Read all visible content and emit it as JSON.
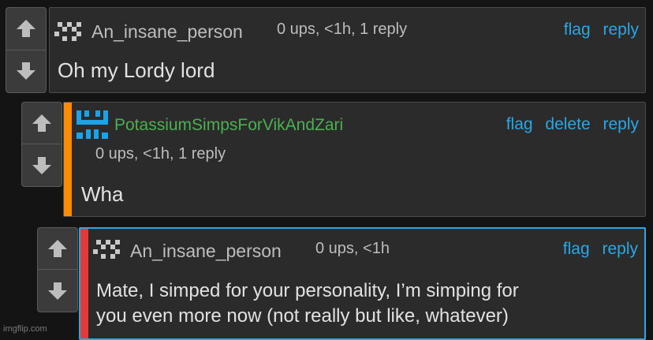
{
  "comments": [
    {
      "username": "An_insane_person",
      "meta": "0 ups, <1h, 1 reply",
      "actions": {
        "flag": "flag",
        "reply": "reply"
      },
      "text": "Oh my Lordy lord"
    },
    {
      "username": "PotassiumSimpsForVikAndZari",
      "meta": "0 ups, <1h, 1 reply",
      "actions": {
        "flag": "flag",
        "delete": "delete",
        "reply": "reply"
      },
      "text": "Wha",
      "stripe_color": "#ff8c00",
      "username_color": "#4caf50",
      "avatar_color": "#1aa3e8"
    },
    {
      "username": "An_insane_person",
      "meta": "0 ups, <1h",
      "actions": {
        "flag": "flag",
        "reply": "reply"
      },
      "text_lines": [
        "Mate, I simped for your personality, I’m simping for",
        "you even more now (not really but like, whatever)"
      ],
      "stripe_color": "#e53935",
      "border_color": "#2aa7e6"
    }
  ],
  "watermark": "imgflip.com",
  "icons": {
    "upvote": "upvote-arrow-icon",
    "downvote": "downvote-arrow-icon"
  }
}
